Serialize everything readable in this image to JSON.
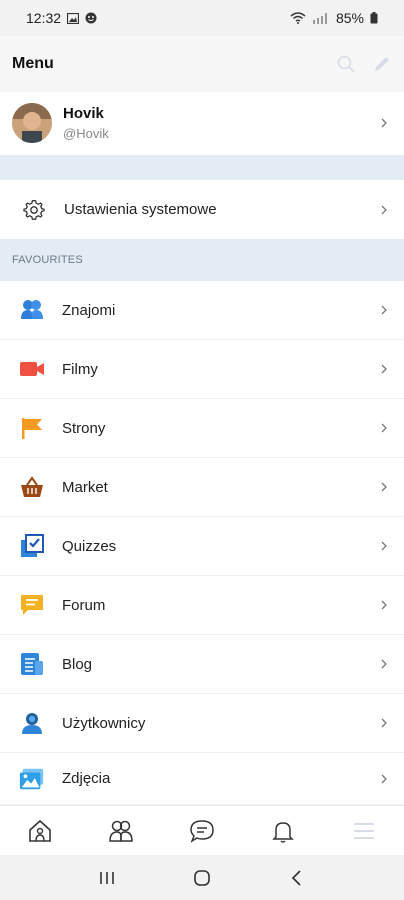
{
  "status_bar": {
    "time": "12:32",
    "battery": "85%"
  },
  "header": {
    "title": "Menu"
  },
  "profile": {
    "name": "Hovik",
    "handle": "@Hovik"
  },
  "settings_item": {
    "label": "Ustawienia systemowe",
    "icon": "gear-icon"
  },
  "favourites": {
    "heading": "FAVOURITES",
    "items": [
      {
        "label": "Znajomi",
        "icon": "friends-icon",
        "color": "#2f7fd8"
      },
      {
        "label": "Filmy",
        "icon": "video-icon",
        "color": "#f0503f"
      },
      {
        "label": "Strony",
        "icon": "flag-icon",
        "color": "#f59a23"
      },
      {
        "label": "Market",
        "icon": "basket-icon",
        "color": "#9a4a14"
      },
      {
        "label": "Quizzes",
        "icon": "quiz-icon",
        "color": "#1f58b5"
      },
      {
        "label": "Forum",
        "icon": "forum-icon",
        "color": "#f5b323"
      },
      {
        "label": "Blog",
        "icon": "blog-icon",
        "color": "#2f86d8"
      },
      {
        "label": "Użytkownicy",
        "icon": "users-icon",
        "color": "#1f5f9a"
      },
      {
        "label": "Zdjęcia",
        "icon": "photos-icon",
        "color": "#2fa0e8"
      }
    ]
  },
  "bottom_nav": [
    "home-icon",
    "friends-nav-icon",
    "chat-icon",
    "bell-icon",
    "menu-icon"
  ],
  "system_nav": [
    "recents-icon",
    "home-circle-icon",
    "back-icon"
  ]
}
